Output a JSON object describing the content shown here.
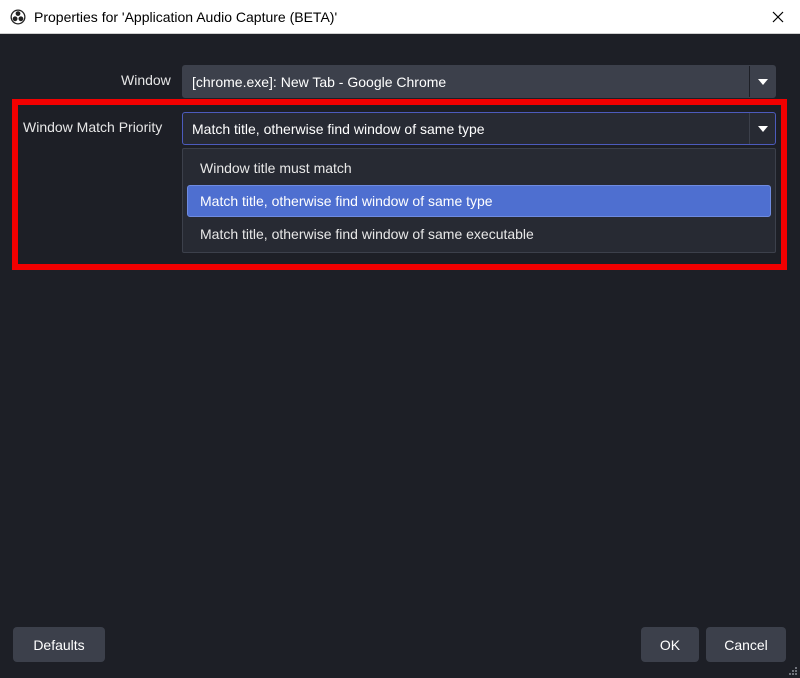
{
  "window": {
    "title": "Properties for 'Application Audio Capture (BETA)'",
    "app_icon": "obs-logo-icon",
    "close_icon": "close-icon"
  },
  "form": {
    "window_label": "Window",
    "window_value": "[chrome.exe]: New Tab - Google Chrome",
    "priority_label": "Window Match Priority",
    "priority_value": "Match title, otherwise find window of same type"
  },
  "dropdown": {
    "options": [
      "Window title must match",
      "Match title, otherwise find window of same type",
      "Match title, otherwise find window of same executable"
    ],
    "selected_index": 1
  },
  "annotation": {
    "highlight_color": "#f20000"
  },
  "buttons": {
    "defaults": "Defaults",
    "ok": "OK",
    "cancel": "Cancel"
  },
  "colors": {
    "background": "#1d1f26",
    "control": "#3c404b",
    "selection": "#4e6fd0",
    "focus_border": "#4c5bbd"
  }
}
